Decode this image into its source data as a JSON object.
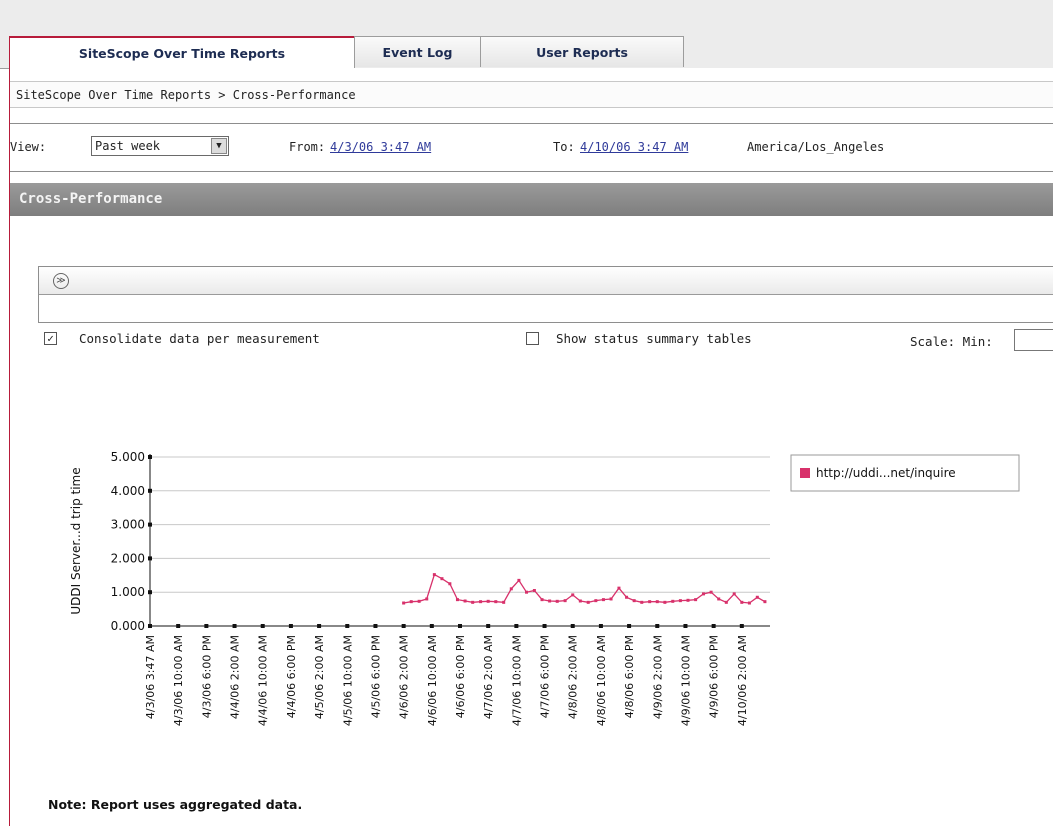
{
  "tabs": [
    {
      "label": "SiteScope Over Time Reports",
      "active": true
    },
    {
      "label": "Event Log",
      "active": false
    },
    {
      "label": "User Reports",
      "active": false
    }
  ],
  "breadcrumb": "SiteScope Over Time Reports > Cross-Performance",
  "view": {
    "label": "View:",
    "selected": "Past week",
    "from_label": "From:",
    "from_value": "4/3/06 3:47 AM",
    "to_label": "To:",
    "to_value": "4/10/06 3:47 AM",
    "timezone": "America/Los_Angeles"
  },
  "panel_title": "Cross-Performance",
  "options": {
    "consolidate_label": "Consolidate data per measurement",
    "consolidate_checked": true,
    "status_label": "Show status summary tables",
    "status_checked": false,
    "scale_label": "Scale: Min:"
  },
  "note": "Note: Report uses aggregated data.",
  "colors": {
    "accent": "#b71b3a",
    "series": "#d8316b",
    "header_gray": "#8a8a8a"
  },
  "chart_data": {
    "type": "line",
    "ylabel": "UDDI Server...d trip time",
    "ylim": [
      0,
      5
    ],
    "yticks": [
      "0.000",
      "1.000",
      "2.000",
      "3.000",
      "4.000",
      "5.000"
    ],
    "xticks": [
      "4/3/06 3:47 AM",
      "4/3/06 10:00 AM",
      "4/3/06 6:00 PM",
      "4/4/06 2:00 AM",
      "4/4/06 10:00 AM",
      "4/4/06 6:00 PM",
      "4/5/06 2:00 AM",
      "4/5/06 10:00 AM",
      "4/5/06 6:00 PM",
      "4/6/06 2:00 AM",
      "4/6/06 10:00 AM",
      "4/6/06 6:00 PM",
      "4/7/06 2:00 AM",
      "4/7/06 10:00 AM",
      "4/7/06 6:00 PM",
      "4/8/06 2:00 AM",
      "4/8/06 10:00 AM",
      "4/8/06 6:00 PM",
      "4/9/06 2:00 AM",
      "4/9/06 10:00 AM",
      "4/9/06 6:00 PM",
      "4/10/06 2:00 AM"
    ],
    "legend_position": "right",
    "grid": true,
    "series": [
      {
        "name": "http://uddi...net/inquire",
        "x": [
          9.0,
          9.27,
          9.55,
          9.82,
          10.09,
          10.36,
          10.64,
          10.91,
          11.18,
          11.45,
          11.73,
          12.0,
          12.27,
          12.55,
          12.82,
          13.09,
          13.36,
          13.64,
          13.91,
          14.18,
          14.45,
          14.73,
          15.0,
          15.27,
          15.55,
          15.82,
          16.09,
          16.36,
          16.64,
          16.91,
          17.18,
          17.45,
          17.73,
          18.0,
          18.27,
          18.55,
          18.82,
          19.09,
          19.36,
          19.64,
          19.91,
          20.18,
          20.45,
          20.73,
          21.0,
          21.27,
          21.55,
          21.82
        ],
        "values": [
          0.68,
          0.72,
          0.73,
          0.8,
          1.52,
          1.4,
          1.25,
          0.78,
          0.74,
          0.7,
          0.72,
          0.73,
          0.72,
          0.7,
          1.1,
          1.35,
          1.0,
          1.05,
          0.78,
          0.74,
          0.73,
          0.75,
          0.92,
          0.74,
          0.7,
          0.75,
          0.78,
          0.8,
          1.12,
          0.85,
          0.75,
          0.7,
          0.72,
          0.72,
          0.7,
          0.73,
          0.75,
          0.76,
          0.78,
          0.95,
          1.0,
          0.8,
          0.7,
          0.95,
          0.7,
          0.68,
          0.85,
          0.72
        ]
      }
    ]
  }
}
